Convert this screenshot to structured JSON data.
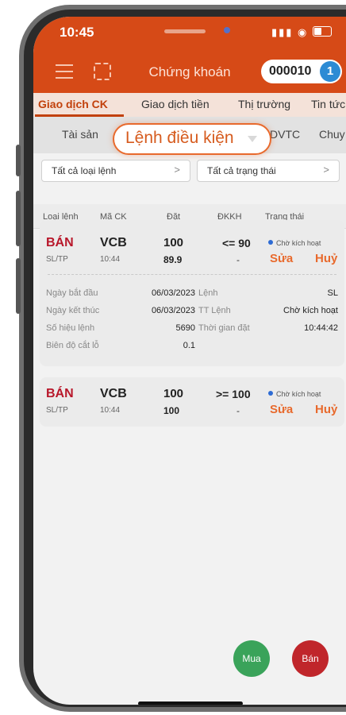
{
  "status_bar": {
    "time": "10:45",
    "signal_icon": "signal-icon",
    "wifi_icon": "wifi-icon",
    "battery_icon": "battery-icon"
  },
  "header": {
    "title": "Chứng khoán",
    "account_number": "000010",
    "account_badge": "1",
    "menu_icon": "hamburger-menu-icon",
    "qr_icon": "qr-scan-icon"
  },
  "main_tabs": [
    "Giao dịch CK",
    "Giao dịch tiền",
    "Thị trường",
    "Tin tức"
  ],
  "sub_tabs": [
    "Tài sản",
    "DVTC",
    "Chuy"
  ],
  "sub_tab_highlight": "Lệnh điều kiện",
  "filters": {
    "order_type": "Tất cả loại lệnh",
    "status": "Tất cả trạng thái"
  },
  "columns": [
    "Loại lệnh",
    "Mã CK",
    "Đặt",
    "ĐKKH",
    "Trạng thái"
  ],
  "orders": [
    {
      "side": "BÁN",
      "type": "SL/TP",
      "symbol": "VCB",
      "time": "10:44",
      "quantity": "100",
      "price": "89.9",
      "condition": "<= 90",
      "condition_sub": "-",
      "status": "Chờ kích hoạt",
      "edit": "Sửa",
      "cancel": "Huỷ",
      "details": {
        "start_label": "Ngày bắt đầu",
        "start": "06/03/2023",
        "end_label": "Ngày kết thúc",
        "end": "06/03/2023",
        "ref_label": "Số hiệu lệnh",
        "ref": "5690",
        "trail_label": "Biên độ cắt lỗ",
        "trail": "0.1",
        "order_label": "Lệnh",
        "order": "SL",
        "order_status_label": "TT Lệnh",
        "order_status": "Chờ kích hoạt",
        "placed_label": "Thời gian đặt",
        "placed": "10:44:42"
      }
    },
    {
      "side": "BÁN",
      "type": "SL/TP",
      "symbol": "VCB",
      "time": "10:44",
      "quantity": "100",
      "price": "100",
      "condition": ">= 100",
      "condition_sub": "-",
      "status": "Chờ kích hoạt",
      "edit": "Sửa",
      "cancel": "Huỷ"
    }
  ],
  "actions": {
    "buy": "Mua",
    "sell": "Bán"
  },
  "colors": {
    "brand": "#d64a17",
    "sell": "#b8172a",
    "buy_fab": "#3aa35a",
    "sell_fab": "#c0262b",
    "accent": "#e86a2d"
  }
}
